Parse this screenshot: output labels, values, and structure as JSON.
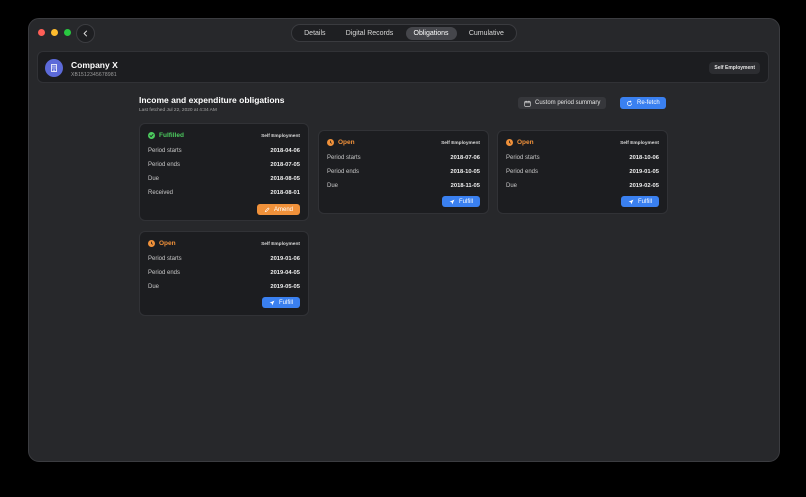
{
  "window": {
    "traffic": {
      "close": "#ff5f57",
      "minimize": "#febc2e",
      "zoom": "#28c840"
    },
    "tabs": [
      {
        "label": "Details",
        "active": false
      },
      {
        "label": "Digital Records",
        "active": false
      },
      {
        "label": "Obligations",
        "active": true
      },
      {
        "label": "Cumulative",
        "active": false
      }
    ]
  },
  "company": {
    "name": "Company X",
    "id": "XB1512345678981",
    "badge": "Self Employment",
    "avatar_icon": "building-icon"
  },
  "section": {
    "title": "Income and expenditure obligations",
    "last_fetched": "Last fetched Jul 22, 2020 at 4:34 AM",
    "custom_label": "Custom period summary",
    "refetch_label": "Re-fetch"
  },
  "colors": {
    "accent": "#3a80f0",
    "fulfilled": "#4ccb5e",
    "open": "#f0913a"
  },
  "obligations": [
    {
      "status": "Fulfilled",
      "type": "Self Employment",
      "rows": [
        {
          "label": "Period starts",
          "value": "2018-04-06"
        },
        {
          "label": "Period ends",
          "value": "2018-07-05"
        },
        {
          "label": "Due",
          "value": "2018-08-05"
        },
        {
          "label": "Received",
          "value": "2018-08-01"
        }
      ],
      "action": "Amend"
    },
    {
      "status": "Open",
      "type": "Self Employment",
      "rows": [
        {
          "label": "Period starts",
          "value": "2018-07-06"
        },
        {
          "label": "Period ends",
          "value": "2018-10-05"
        },
        {
          "label": "Due",
          "value": "2018-11-05"
        }
      ],
      "action": "Fulfill"
    },
    {
      "status": "Open",
      "type": "Self Employment",
      "rows": [
        {
          "label": "Period starts",
          "value": "2018-10-06"
        },
        {
          "label": "Period ends",
          "value": "2019-01-05"
        },
        {
          "label": "Due",
          "value": "2019-02-05"
        }
      ],
      "action": "Fulfill"
    },
    {
      "status": "Open",
      "type": "Self Employment",
      "rows": [
        {
          "label": "Period starts",
          "value": "2019-01-06"
        },
        {
          "label": "Period ends",
          "value": "2019-04-05"
        },
        {
          "label": "Due",
          "value": "2019-05-05"
        }
      ],
      "action": "Fulfill"
    }
  ]
}
